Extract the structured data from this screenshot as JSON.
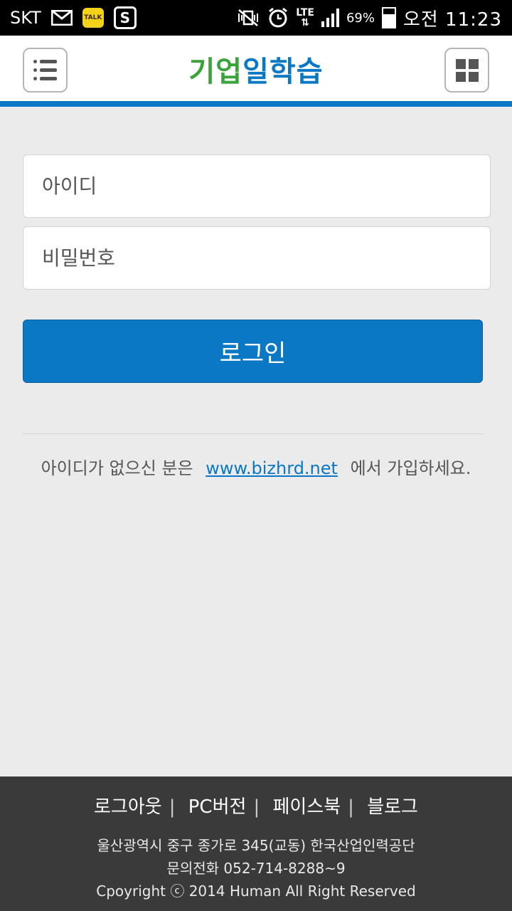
{
  "status_bar": {
    "carrier": "SKT",
    "talk_label": "TALK",
    "s_icon_label": "S",
    "network": "LTE",
    "battery": "69%",
    "battery_level": 0.69,
    "time": "오전 11:23"
  },
  "header": {
    "logo_part1": "기업",
    "logo_part2": "일학습",
    "menu_icon": "list-icon",
    "grid_icon": "grid-icon",
    "colors": {
      "accent": "#0a78c4",
      "logo_green": "#3aa33a"
    }
  },
  "form": {
    "id_placeholder": "아이디",
    "id_value": "",
    "password_placeholder": "비밀번호",
    "password_value": "",
    "login_label": "로그인"
  },
  "signup": {
    "prefix": "아이디가 없으신 분은",
    "link_text": "www.bizhrd.net",
    "suffix": "에서 가입하세요."
  },
  "footer": {
    "links": [
      "로그아웃",
      "PC버전",
      "페이스북",
      "블로그"
    ],
    "separator": "|",
    "address": "울산광역시 중구 종가로 345(교동) 한국산업인력공단",
    "phone": "문의전화 052-714-8288~9",
    "copyright": "Cpoyright ⓒ 2014 Human All Right Reserved"
  }
}
